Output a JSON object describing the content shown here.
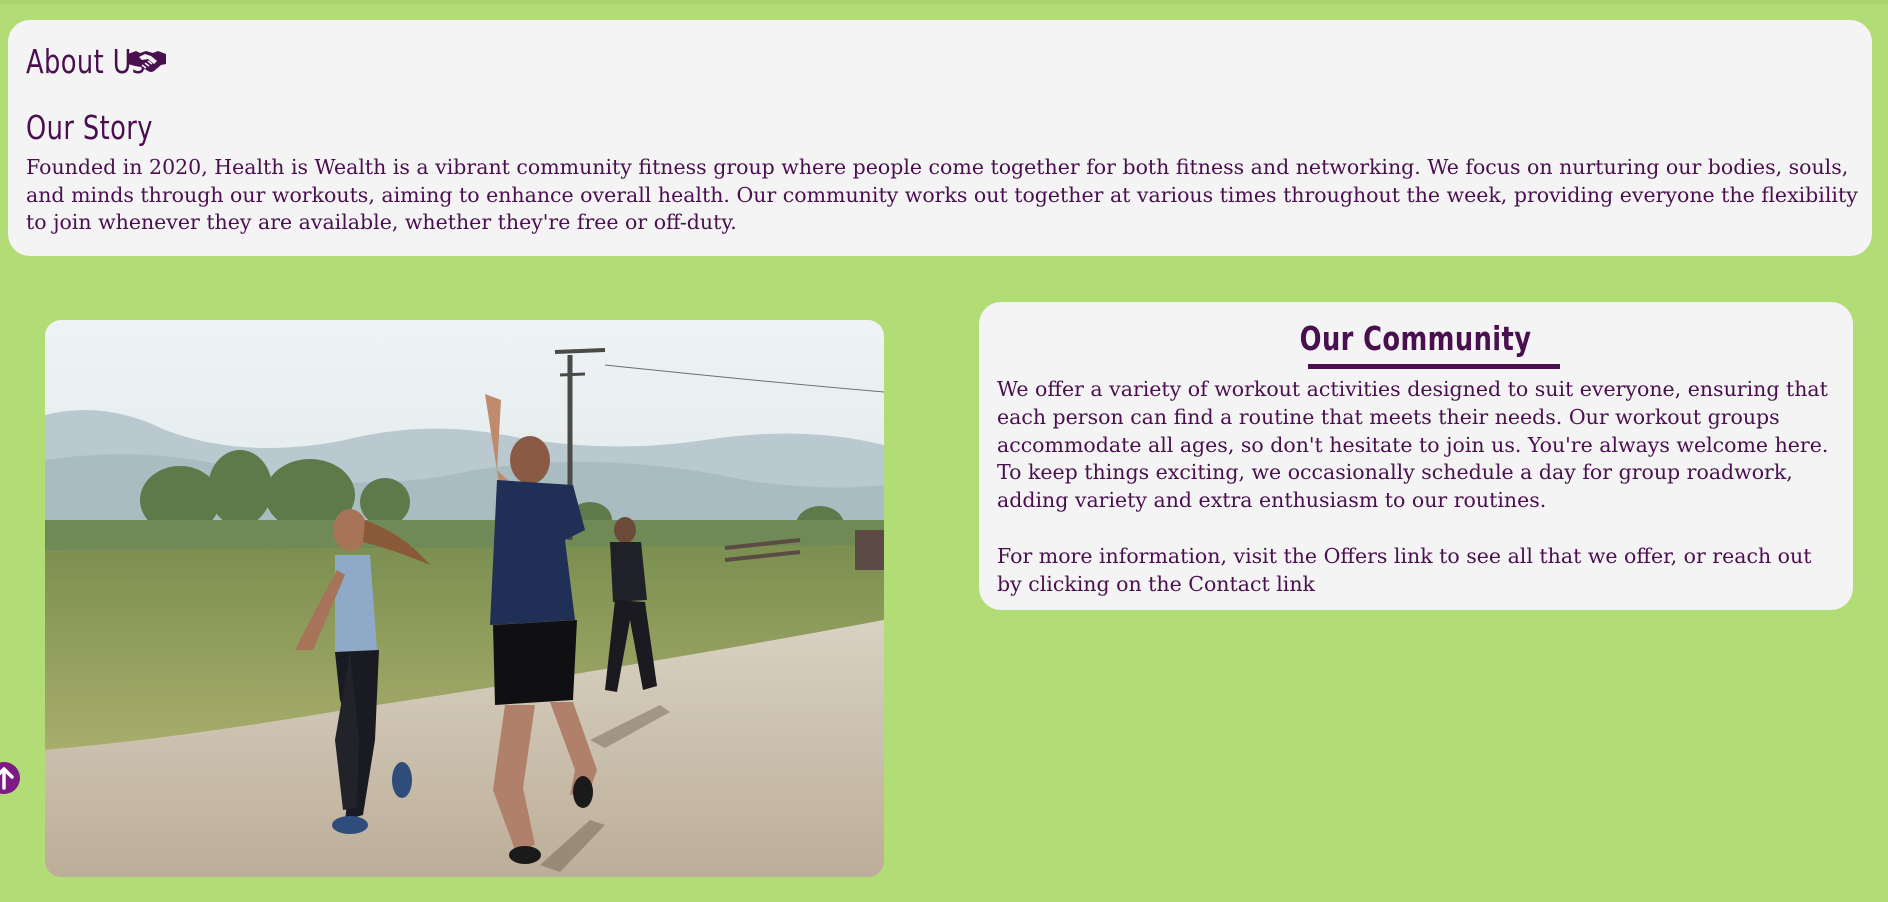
{
  "about": {
    "title": "About Us",
    "icon": "handshake-icon",
    "story_title": "Our Story",
    "story_text": "Founded in 2020, Health is Wealth is a vibrant community fitness group where people come together for both fitness and networking. We focus on nurturing our bodies, souls, and minds through our workouts, aiming to enhance overall health. Our community works out together at various times throughout the week, providing everyone the flexibility to join whenever they are available, whether they're free or off-duty."
  },
  "community": {
    "title": "Our Community",
    "paragraph1": "We offer a variety of workout activities designed to suit everyone, ensuring that each person can find a routine that meets their needs. Our workout groups accommodate all ages, so don't hesitate to join us. You're always welcome here.",
    "paragraph2": "To keep things exciting, we occasionally schedule a day for group roadwork, adding variety and extra enthusiasm to our routines.",
    "info_prefix": "For more information, visit the ",
    "offers_link": "Offers link",
    "info_middle": " to see all that we offer, or reach out by clicking on the ",
    "contact_link": "Contact link"
  },
  "photo": {
    "subject": "three runners on a dirt road"
  },
  "back_to_top": {
    "icon": "arrow-up-circle-icon"
  },
  "colors": {
    "background": "#b2dc76",
    "card": "#f4f4f4",
    "text": "#4a0f4f",
    "accent": "#7c1b84"
  }
}
